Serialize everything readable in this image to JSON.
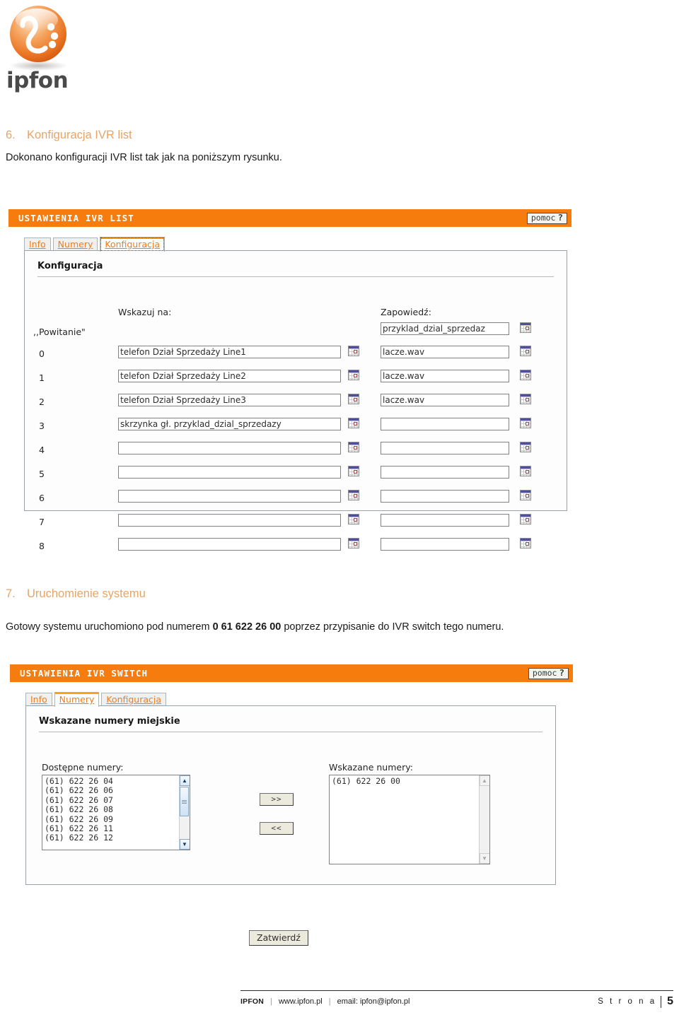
{
  "brand": {
    "logo_text": "ipfon"
  },
  "sections": [
    {
      "number": "6.",
      "title": "Konfiguracja IVR list",
      "paragraph": "Dokonano konfiguracji IVR list tak jak na poniższym rysunku."
    },
    {
      "number": "7.",
      "title": "Uruchomienie systemu",
      "paragraph_before": "Gotowy systemu uruchomiono pod numerem ",
      "paragraph_bold": "0 61 622 26 00",
      "paragraph_after": " poprzez przypisanie do IVR switch tego numeru."
    }
  ],
  "ivr_list_panel": {
    "header_title": "USTAWIENIA IVR LIST",
    "help_label": "pomoc",
    "help_mark": "?",
    "tabs": [
      {
        "label": "Info",
        "active": false
      },
      {
        "label": "Numery",
        "active": false
      },
      {
        "label": "Konfiguracja",
        "active": true
      }
    ],
    "section_title": "Konfiguracja",
    "col_headers": {
      "left": "Wskazuj na:",
      "right": "Zapowiedź:"
    },
    "greeting_label": ",,Powitanie\"",
    "greeting_announcement": "przyklad_dzial_sprzedaz",
    "rows": [
      {
        "key": "0",
        "target": "telefon Dział Sprzedaży  Line1",
        "announcement": "lacze.wav"
      },
      {
        "key": "1",
        "target": "telefon Dział Sprzedaży  Line2",
        "announcement": "lacze.wav"
      },
      {
        "key": "2",
        "target": "telefon Dział Sprzedaży  Line3",
        "announcement": "lacze.wav"
      },
      {
        "key": "3",
        "target": "skrzynka gł. przyklad_dzial_sprzedazy",
        "announcement": ""
      },
      {
        "key": "4",
        "target": "",
        "announcement": ""
      },
      {
        "key": "5",
        "target": "",
        "announcement": ""
      },
      {
        "key": "6",
        "target": "",
        "announcement": ""
      },
      {
        "key": "7",
        "target": "",
        "announcement": ""
      },
      {
        "key": "8",
        "target": "",
        "announcement": ""
      }
    ]
  },
  "ivr_switch_panel": {
    "header_title": "USTAWIENIA IVR SWITCH",
    "help_label": "pomoc",
    "help_mark": "?",
    "tabs": [
      {
        "label": "Info",
        "active": false
      },
      {
        "label": "Numery",
        "active": true
      },
      {
        "label": "Konfiguracja",
        "active": false
      }
    ],
    "section_title": "Wskazane numery miejskie",
    "available_label": "Dostępne numery:",
    "assigned_label": "Wskazane numery:",
    "available_numbers": [
      "(61) 622 26 04",
      "(61) 622 26 06",
      "(61) 622 26 07",
      "(61) 622 26 08",
      "(61) 622 26 09",
      "(61) 622 26 11",
      "(61) 622 26 12"
    ],
    "assigned_numbers": [
      "(61) 622 26 00"
    ],
    "move_right_label": ">>",
    "move_left_label": "<<",
    "submit_label": "Zatwierdź"
  },
  "footer": {
    "brand": "IPFON",
    "website": "www.ipfon.pl",
    "email": "email: ipfon@ipfon.pl",
    "page_label": "S t r o n a",
    "page_number": "5"
  },
  "colors": {
    "accent_orange": "#f57c0d",
    "heading_orange": "#e8a466",
    "tab_link": "#f07d1a"
  }
}
